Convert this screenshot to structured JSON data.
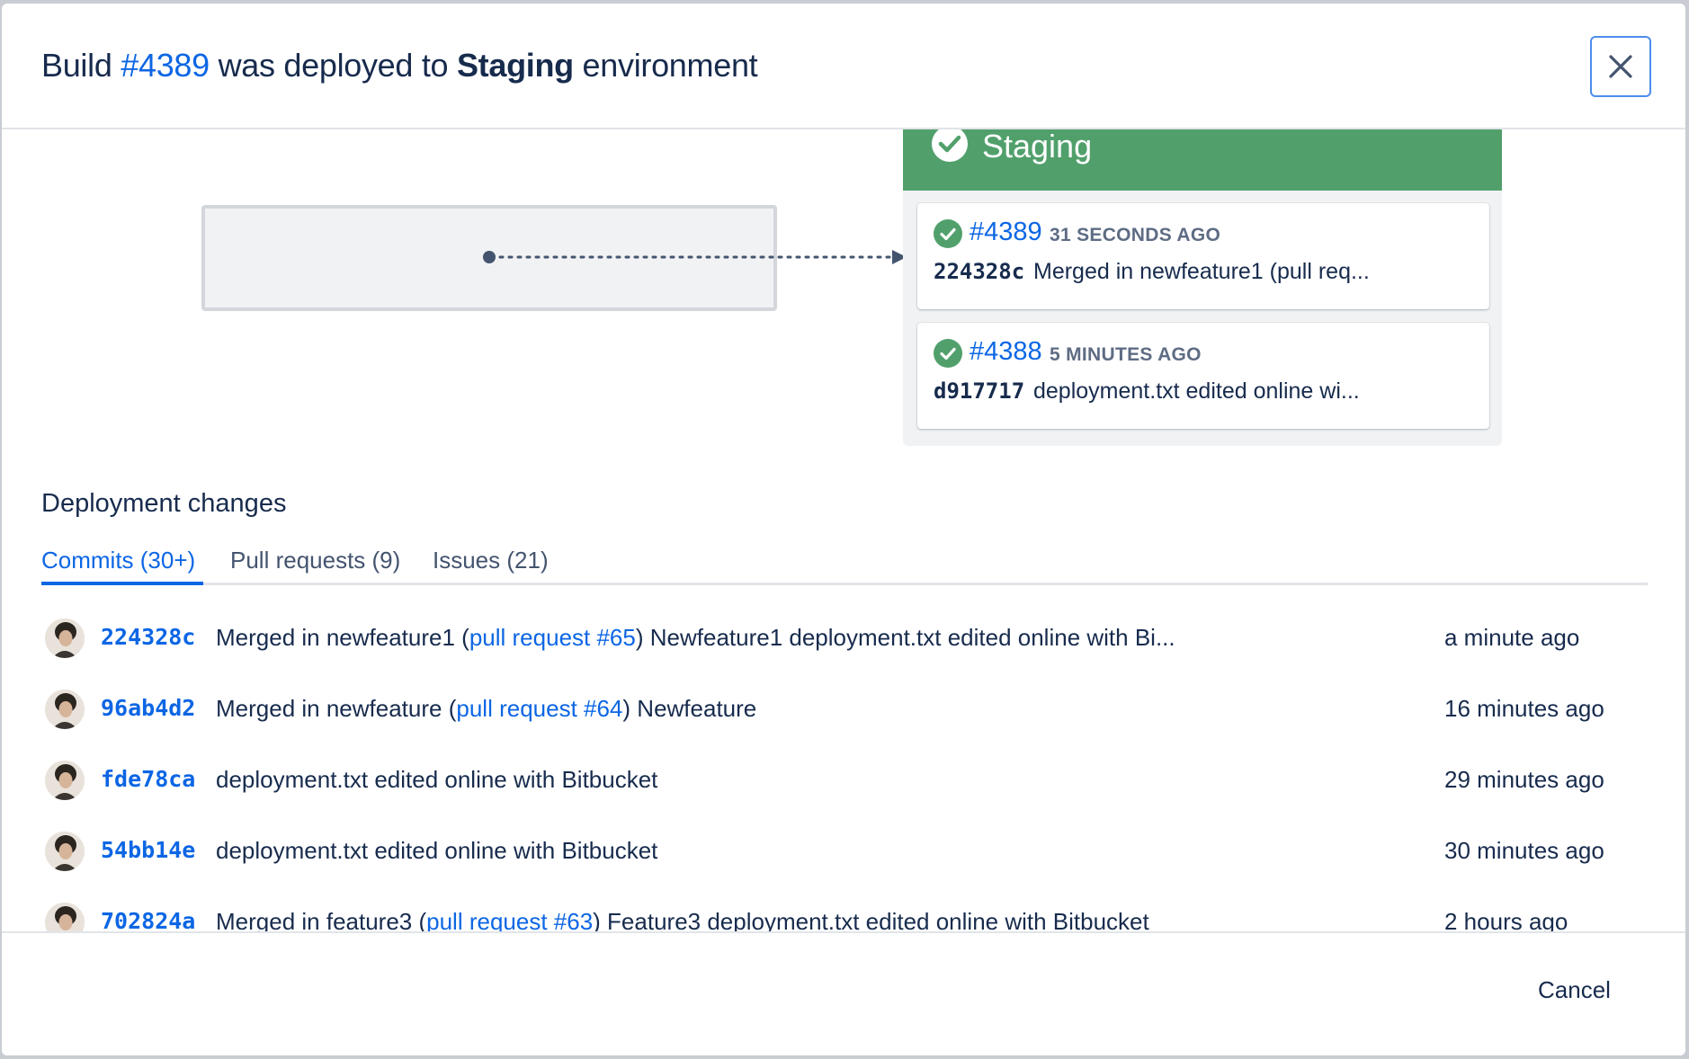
{
  "dialog": {
    "title": {
      "prefix": "Build ",
      "build_link": "#4389",
      "middle": " was deployed to ",
      "environment": "Staging",
      "suffix": " environment"
    },
    "close_label": "Close"
  },
  "pipeline": {
    "environment_name": "Staging",
    "status_color": "#51a06c",
    "deployments": [
      {
        "build": "#4389",
        "time": "31 SECONDS AGO",
        "hash": "224328c",
        "message": "Merged in newfeature1 (pull req..."
      },
      {
        "build": "#4388",
        "time": "5 MINUTES AGO",
        "hash": "d917717",
        "message": "deployment.txt edited online wi..."
      }
    ]
  },
  "changes": {
    "title": "Deployment changes",
    "tabs": [
      {
        "label": "Commits (30+)",
        "active": true
      },
      {
        "label": "Pull requests (9)",
        "active": false
      },
      {
        "label": "Issues (21)",
        "active": false
      }
    ],
    "commits": [
      {
        "hash": "224328c",
        "msg_before": "Merged in newfeature1 (",
        "pr": "pull request #65",
        "msg_after": ") Newfeature1 deployment.txt edited online with Bi...",
        "time": "a minute ago"
      },
      {
        "hash": "96ab4d2",
        "msg_before": "Merged in newfeature (",
        "pr": "pull request #64",
        "msg_after": ") Newfeature",
        "time": "16 minutes ago"
      },
      {
        "hash": "fde78ca",
        "msg_before": "deployment.txt edited online with Bitbucket",
        "pr": "",
        "msg_after": "",
        "time": "29 minutes ago"
      },
      {
        "hash": "54bb14e",
        "msg_before": "deployment.txt edited online with Bitbucket",
        "pr": "",
        "msg_after": "",
        "time": "30 minutes ago"
      },
      {
        "hash": "702824a",
        "msg_before": "Merged in feature3 (",
        "pr": "pull request #63",
        "msg_after": ") Feature3 deployment.txt edited online with Bitbucket",
        "time": "2 hours ago"
      }
    ]
  },
  "footer": {
    "cancel_label": "Cancel"
  },
  "colors": {
    "link": "#0c66e4",
    "text": "#172b4d",
    "success": "#51a06c"
  },
  "icons": {
    "close": "close-icon",
    "check": "check-circle-icon",
    "avatar": "user-avatar"
  }
}
